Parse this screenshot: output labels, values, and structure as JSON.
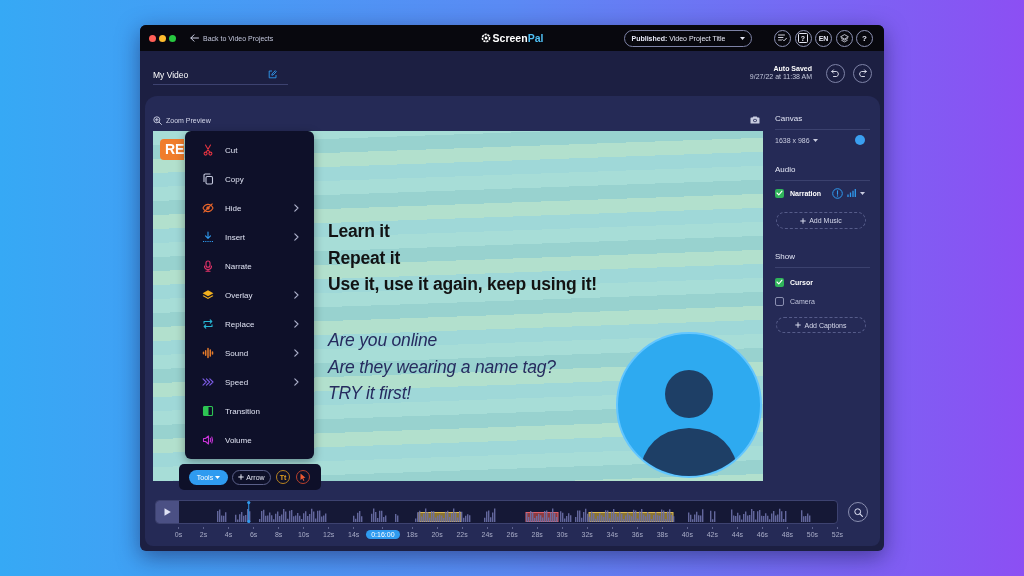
{
  "top_bar": {
    "back_link": "Back to Video Projects",
    "logo": [
      "Screen",
      "Pal"
    ],
    "publish_dropdown": "**Published:** Video Project Title",
    "actions": [
      {
        "kind": "checklist"
      },
      {
        "kind": "question_box",
        "text": "?"
      },
      {
        "kind": "language",
        "text": "EN"
      },
      {
        "kind": "layers"
      },
      {
        "kind": "help",
        "text": "?"
      }
    ]
  },
  "header": {
    "project_title": "My Video",
    "save_status": "Auto Saved",
    "save_time": "9/27/22 at 11:38 AM"
  },
  "preview": {
    "zoom_label": "Zoom Preview",
    "tag": "RE",
    "text_lines": [
      {
        "text": "Learn it",
        "kind": "bold"
      },
      {
        "text": "Repeat it",
        "kind": "bold"
      },
      {
        "text": "Use it, use it again, keep using it!",
        "kind": "bold"
      },
      {
        "text": "Are you online",
        "kind": "italic"
      },
      {
        "text": "Are they wearing a name tag?",
        "kind": "italic"
      },
      {
        "text": "TRY it first!",
        "kind": "italic"
      }
    ]
  },
  "context_menu": {
    "items": [
      {
        "label": "Cut",
        "submenu": false
      },
      {
        "label": "Copy",
        "submenu": false
      },
      {
        "label": "Hide",
        "submenu": true
      },
      {
        "label": "Insert",
        "submenu": true
      },
      {
        "label": "Narrate",
        "submenu": false
      },
      {
        "label": "Overlay",
        "submenu": true
      },
      {
        "label": "Replace",
        "submenu": true
      },
      {
        "label": "Sound",
        "submenu": true
      },
      {
        "label": "Speed",
        "submenu": true
      },
      {
        "label": "Transition",
        "submenu": false
      },
      {
        "label": "Volume",
        "submenu": false
      }
    ]
  },
  "tools_bar": {
    "tools_button": "Tools",
    "arrow_button": "Arrow",
    "text_tool": "Tt"
  },
  "settings": {
    "canvas": {
      "title": "Canvas",
      "size": "1638 x 986",
      "color": "#3a9ff0"
    },
    "audio": {
      "title": "Audio",
      "tracks": [
        {
          "label": "Narration",
          "checked": true
        }
      ],
      "add_button": "Add Music"
    },
    "show": {
      "title": "Show",
      "options": [
        {
          "label": "Cursor",
          "checked": true
        },
        {
          "label": "Camera",
          "checked": false
        }
      ],
      "add_button": "Add Captions"
    }
  },
  "timeline": {
    "playhead": {
      "level": 0.106
    },
    "segments": [
      {
        "color": "#8a7434"
      },
      {
        "color": "#8c3c42"
      },
      {
        "color": "#8a7434"
      }
    ],
    "ticks": [
      {
        "label": "0s",
        "selected": false
      },
      {
        "label": "2s",
        "selected": false
      },
      {
        "label": "4s",
        "selected": false
      },
      {
        "label": "6s",
        "selected": false
      },
      {
        "label": "8s",
        "selected": false
      },
      {
        "label": "10s",
        "selected": false
      },
      {
        "label": "12s",
        "selected": false
      },
      {
        "label": "14s",
        "selected": false
      },
      {
        "label": "0:16:00",
        "selected": true
      },
      {
        "label": "18s",
        "selected": false
      },
      {
        "label": "20s",
        "selected": false
      },
      {
        "label": "22s",
        "selected": false
      },
      {
        "label": "24s",
        "selected": false
      },
      {
        "label": "26s",
        "selected": false
      },
      {
        "label": "28s",
        "selected": false
      },
      {
        "label": "30s",
        "selected": false
      },
      {
        "label": "32s",
        "selected": false
      },
      {
        "label": "34s",
        "selected": false
      },
      {
        "label": "36s",
        "selected": false
      },
      {
        "label": "38s",
        "selected": false
      },
      {
        "label": "40s",
        "selected": false
      },
      {
        "label": "42s",
        "selected": false
      },
      {
        "label": "44s",
        "selected": false
      },
      {
        "label": "46s",
        "selected": false
      },
      {
        "label": "48s",
        "selected": false
      },
      {
        "label": "50s",
        "selected": false
      },
      {
        "label": "52s",
        "selected": false
      }
    ]
  }
}
